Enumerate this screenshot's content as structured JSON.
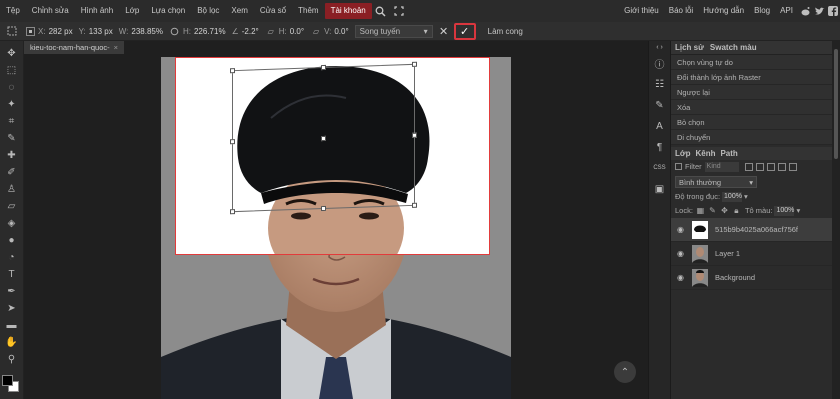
{
  "menu": {
    "items": [
      "Tệp",
      "Chỉnh sửa",
      "Hình ảnh",
      "Lớp",
      "Lựa chọn",
      "Bộ lọc",
      "Xem",
      "Cửa sổ",
      "Thêm",
      "Tài khoản"
    ],
    "active_index": 9,
    "right_links": [
      "Giới thiệu",
      "Báo lỗi",
      "Hướng dẫn",
      "Blog",
      "API"
    ],
    "icons": [
      "search-icon",
      "fullscreen-icon"
    ],
    "social_icons": [
      "reddit-icon",
      "twitter-icon",
      "facebook-icon"
    ]
  },
  "options": {
    "x_label": "X:",
    "x_value": "282 px",
    "y_label": "Y:",
    "y_value": "133 px",
    "w_label": "W:",
    "w_value": "238.85%",
    "h_label": "H:",
    "h_value": "226.71%",
    "angle_label": "∠",
    "angle_value": "-2.2°",
    "skew_h_label": "H:",
    "skew_h_value": "0.0°",
    "skew_v_label": "V:",
    "skew_v_value": "0.0°",
    "interpolation": "Song tuyến",
    "warp_label": "Làm cong",
    "cancel_symbol": "✕",
    "confirm_symbol": "✓"
  },
  "document": {
    "tab_title": "kieu-toc-nam-han-quoc-",
    "tab_close": "×",
    "scroll_top_symbol": "⌃"
  },
  "history_panel": {
    "tabs": [
      "Lịch sử",
      "Swatch màu"
    ],
    "items": [
      "Chọn vùng tự do",
      "Đổi thành lớp ảnh Raster",
      "Ngược lại",
      "Xóa",
      "Bỏ chọn",
      "Di chuyển"
    ]
  },
  "layers_panel": {
    "tabs": [
      "Lớp",
      "Kênh",
      "Path"
    ],
    "filter_label": "Filter",
    "kind_placeholder": "Kind",
    "blend_mode": "Bình thường",
    "opacity_label": "Độ trong đục:",
    "opacity_value": "100%",
    "lock_label": "Lock:",
    "fill_label": "Tô màu:",
    "fill_value": "100%",
    "layers": [
      {
        "name": "515b9b4025a066acf756f",
        "selected": true
      },
      {
        "name": "Layer 1",
        "selected": false
      },
      {
        "name": "Background",
        "selected": false
      }
    ]
  },
  "panel_side_icons": [
    "info-icon",
    "sliders-icon",
    "brush-settings-icon",
    "character-icon",
    "paragraph-icon",
    "css-icon",
    "image-icon"
  ],
  "panel_side_css_label": "CSS",
  "colors": {
    "accent_red": "#d9363e",
    "menu_active_bg": "#8a1f24",
    "panel_bg": "#2b2b2b",
    "canvas_bg": "#1f1f1f"
  }
}
